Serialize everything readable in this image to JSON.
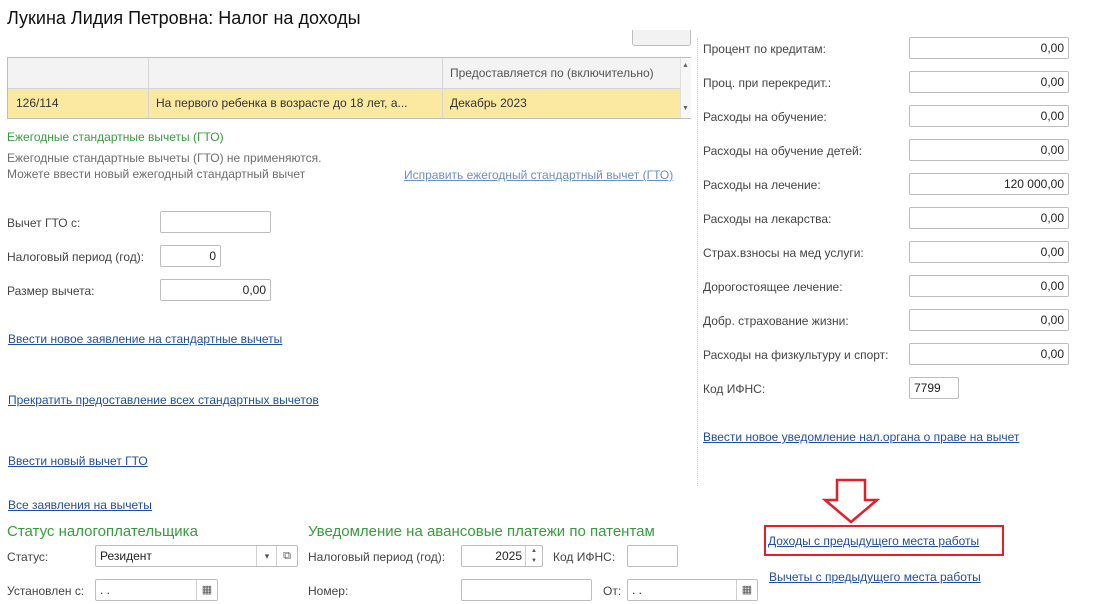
{
  "header": {
    "title": "Лукина Лидия Петровна: Налог на доходы"
  },
  "grid": {
    "columns": [
      "",
      "",
      "Предоставляется по (включительно)"
    ],
    "rows": [
      {
        "code": "126/114",
        "name": "На первого ребенка в возрасте до 18 лет, а...",
        "until": "Декабрь 2023"
      }
    ]
  },
  "gto": {
    "title": "Ежегодные стандартные вычеты (ГТО)",
    "note1": "Ежегодные стандартные вычеты (ГТО) не применяются.",
    "note2": "Можете ввести новый ежегодный стандартный вычет",
    "fix_link": "Исправить ежегодный стандартный вычет (ГТО)",
    "from_label": "Вычет ГТО с:",
    "from_value": "",
    "period_label": "Налоговый период (год):",
    "period_value": "0",
    "size_label": "Размер вычета:",
    "size_value": "0,00"
  },
  "links": {
    "new_application": "Ввести новое заявление на стандартные вычеты",
    "stop_all": "Прекратить предоставление всех стандартных вычетов",
    "new_gto": "Ввести новый вычет ГТО",
    "all_applications": "Все заявления на вычеты",
    "new_notice": "Ввести новое уведомление нал.органа о праве на вычет",
    "prev_income": "Доходы с предыдущего места работы",
    "prev_deductions": "Вычеты с предыдущего места работы"
  },
  "right_fields": [
    {
      "label": "Процент по кредитам:",
      "value": "0,00"
    },
    {
      "label": "Проц. при перекредит.:",
      "value": "0,00"
    },
    {
      "label": "Расходы на обучение:",
      "value": "0,00"
    },
    {
      "label": "Расходы на обучение детей:",
      "value": "0,00"
    },
    {
      "label": "Расходы на лечение:",
      "value": "120 000,00"
    },
    {
      "label": "Расходы на лекарства:",
      "value": "0,00"
    },
    {
      "label": "Страх.взносы на мед услуги:",
      "value": "0,00"
    },
    {
      "label": "Дорогостоящее лечение:",
      "value": "0,00"
    },
    {
      "label": "Добр. страхование жизни:",
      "value": "0,00"
    },
    {
      "label": "Расходы на физкультуру и спорт:",
      "value": "0,00"
    }
  ],
  "ifns": {
    "label": "Код ИФНС:",
    "value": "7799"
  },
  "status": {
    "title": "Статус налогоплательщика",
    "status_label": "Статус:",
    "status_value": "Резидент",
    "set_label": "Установлен с:",
    "set_value": " .  ."
  },
  "patent": {
    "title": "Уведомление на авансовые платежи по патентам",
    "period_label": "Налоговый период (год):",
    "period_value": "2025",
    "ifns_label": "Код ИФНС:",
    "ifns_value": "",
    "number_label": "Номер:",
    "number_value": "",
    "from_label": "От:",
    "from_value": " .  ."
  },
  "colors": {
    "accent_green": "#3a9a3f",
    "link_blue": "#1f4e9e",
    "row_highlight": "#fbe9a2",
    "annotation_red": "#e0202a"
  }
}
